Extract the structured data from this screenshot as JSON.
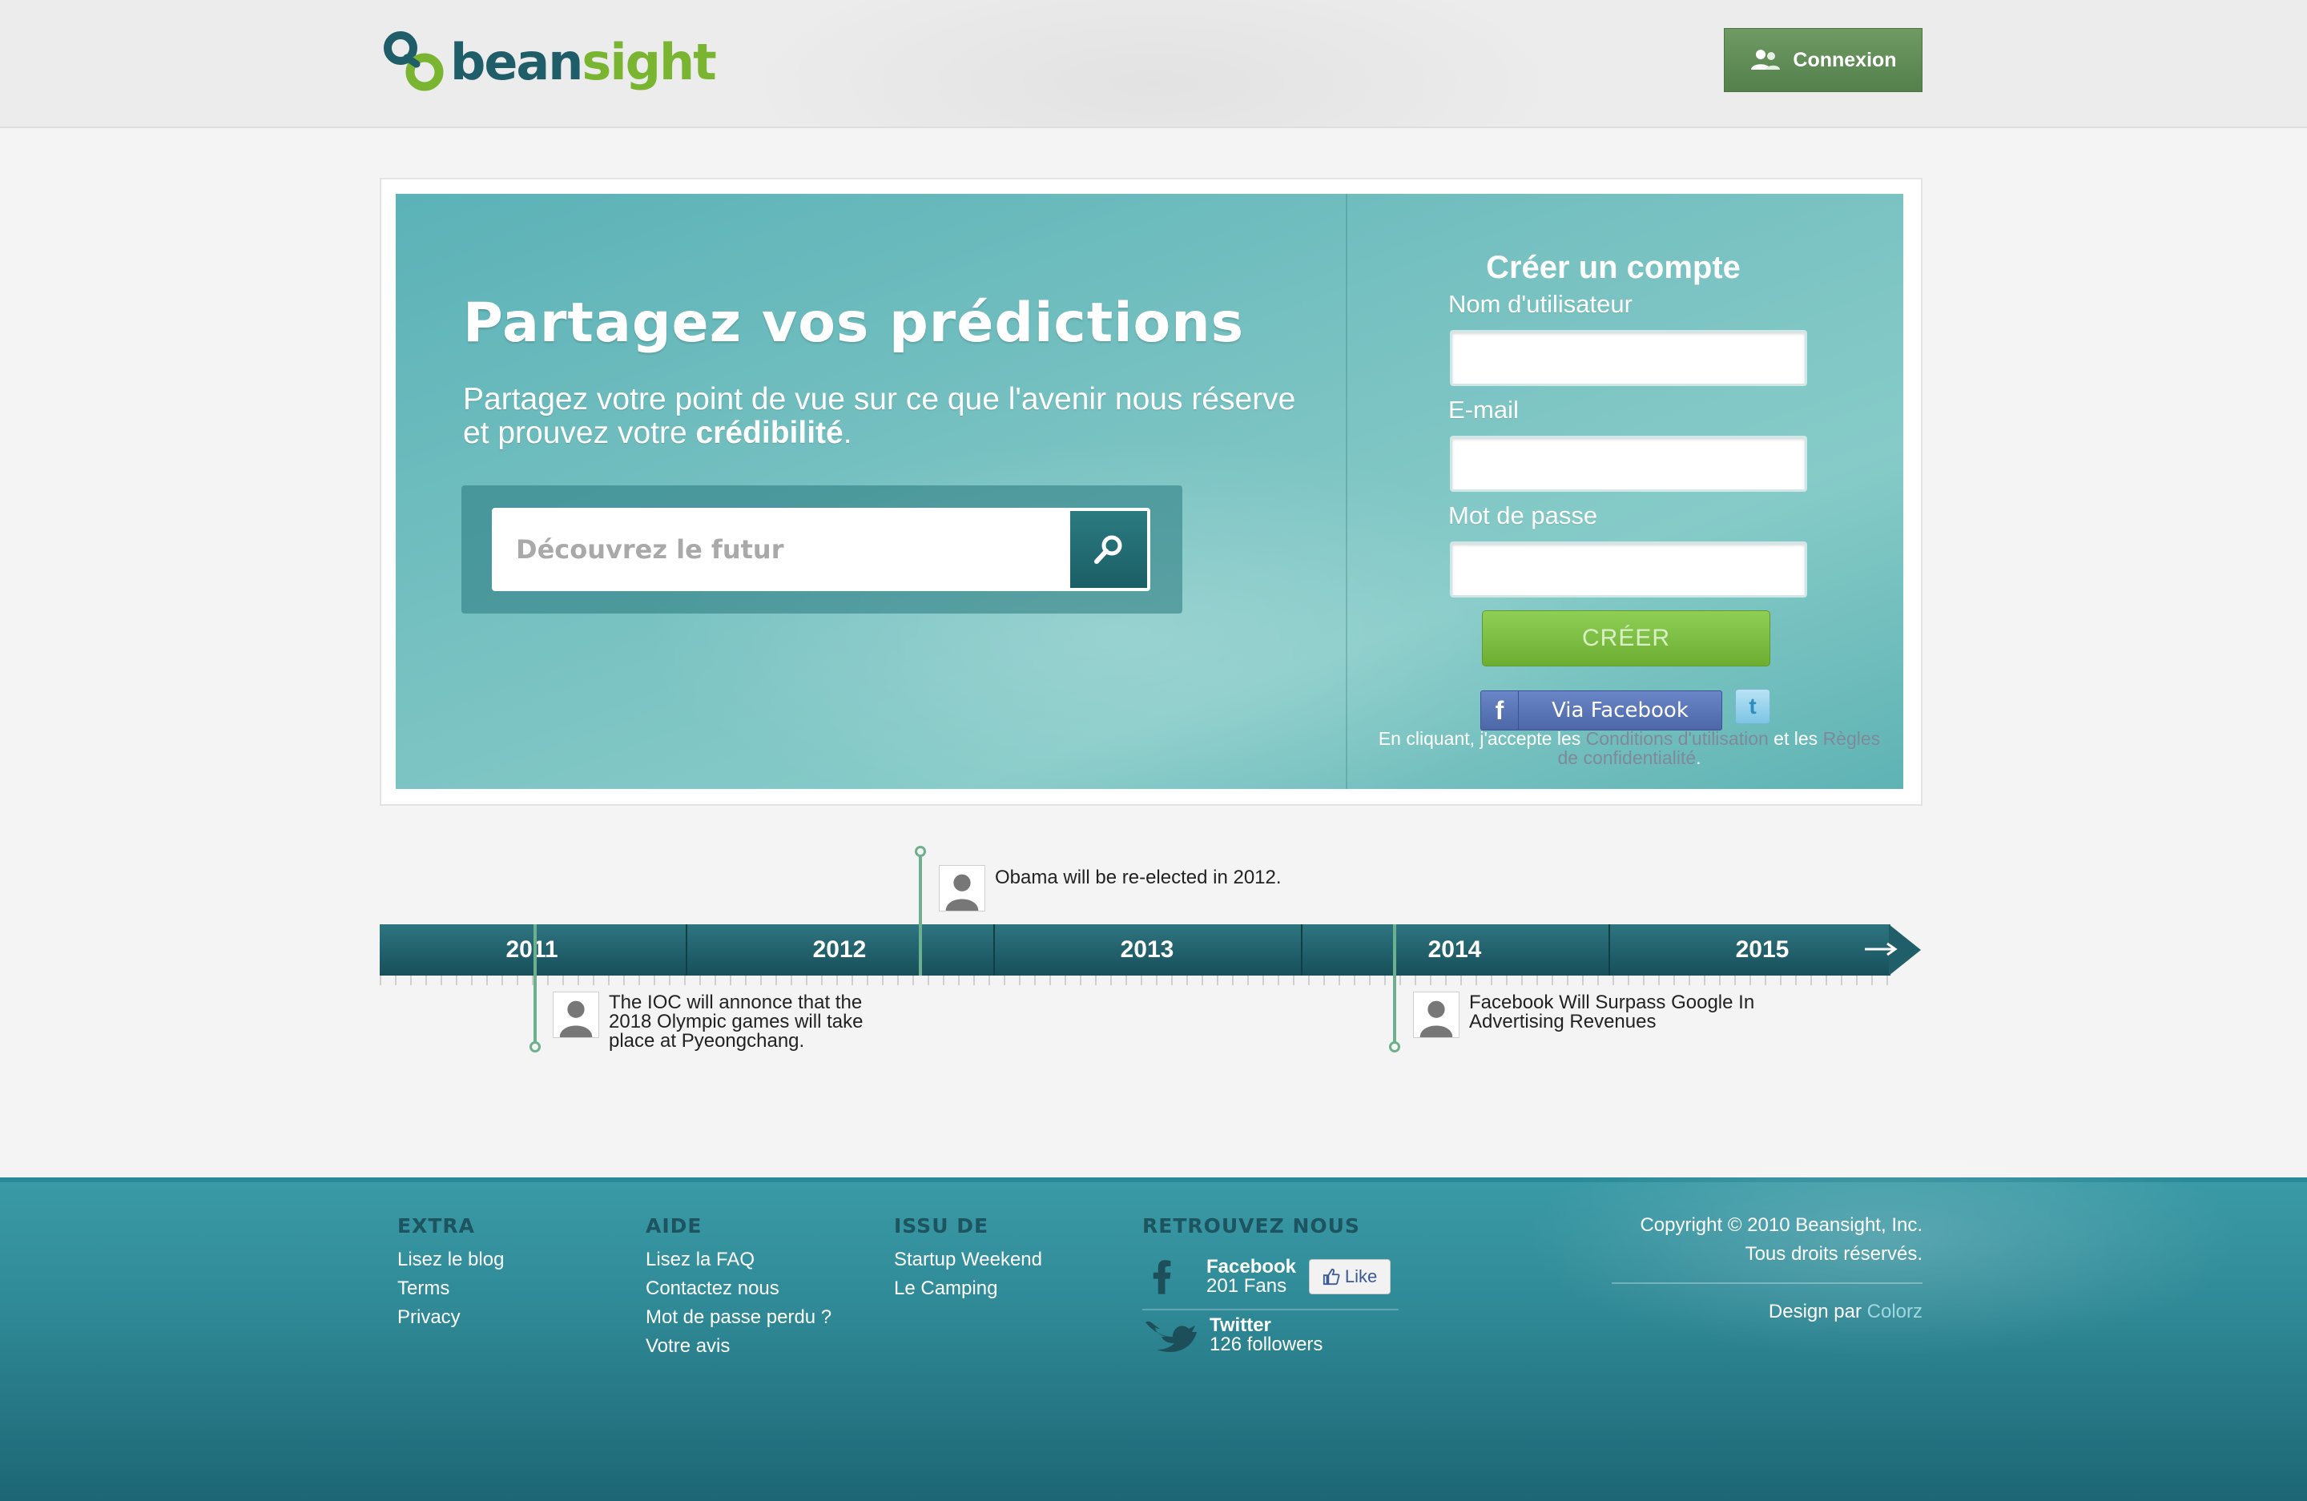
{
  "header": {
    "logo": {
      "part1": "bean",
      "part2": "sight"
    },
    "login_label": "Connexion"
  },
  "hero": {
    "title": "Partagez vos prédictions",
    "subtitle_prefix": "Partagez votre point de vue sur ce que l'avenir nous réserve et prouvez votre ",
    "subtitle_bold": "crédibilité",
    "subtitle_suffix": ".",
    "search_placeholder": "Découvrez le futur"
  },
  "signup": {
    "title": "Créer un compte",
    "username_label": "Nom d'utilisateur",
    "email_label": "E-mail",
    "password_label": "Mot de passe",
    "create_label": "CRÉER",
    "facebook_label": "Via Facebook",
    "twitter_icon": "t",
    "terms_text1": "En cliquant, j'accepte les ",
    "terms_link1": "Conditions d'utilisation",
    "terms_text2": " et les ",
    "terms_link2": "Règles de confidentialité",
    "terms_text3": "."
  },
  "timeline": {
    "years": [
      "2011",
      "2012",
      "2013",
      "2014",
      "2015"
    ],
    "events": [
      {
        "text": "Obama will be re-elected in 2012."
      },
      {
        "text": "The IOC will annonce that the 2018 Olympic games will take place at Pyeongchang."
      },
      {
        "text": "Facebook Will Surpass Google In Advertising Revenues"
      }
    ]
  },
  "footer": {
    "extra": {
      "heading": "EXTRA",
      "links": [
        "Lisez le blog",
        "Terms",
        "Privacy"
      ]
    },
    "aide": {
      "heading": "AIDE",
      "links": [
        "Lisez la FAQ",
        "Contactez nous",
        "Mot de passe perdu ?",
        "Votre avis"
      ]
    },
    "issu": {
      "heading": "ISSU DE",
      "links": [
        "Startup Weekend",
        "Le Camping"
      ]
    },
    "social": {
      "heading": "RETROUVEZ NOUS",
      "facebook_name": "Facebook",
      "facebook_count": "201 Fans",
      "like_label": "Like",
      "twitter_name": "Twitter",
      "twitter_count": "126 followers"
    },
    "copyright_line1": "Copyright © 2010 Beansight, Inc.",
    "copyright_line2": "Tous droits réservés.",
    "design_prefix": "Design par ",
    "design_link": "Colorz"
  },
  "colors": {
    "brand_dark": "#1f5d68",
    "brand_green": "#79b531",
    "hero_teal": "#79c2c2",
    "timeline_bar": "#1f5e69",
    "footer_teal": "#2f8996"
  }
}
